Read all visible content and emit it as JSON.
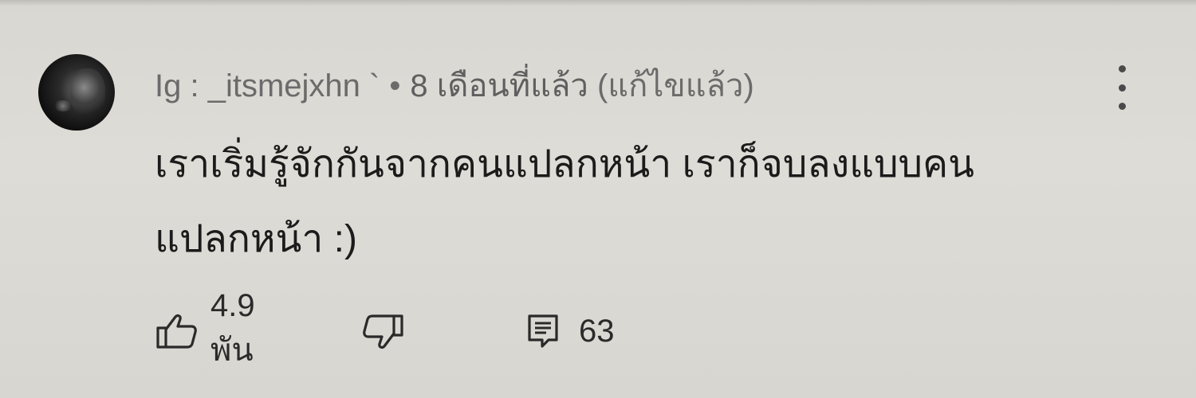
{
  "comment": {
    "author": "Ig : _itsmejxhn `",
    "separator": "•",
    "timestamp": "8 เดือนที่แล้ว",
    "edited_label": "(แก้ไขแล้ว)",
    "text_lines": [
      "เราเริ่มรู้จักกันจากคนแปลกหน้า เราก็จบลงแบบคน",
      "แปลกหน้า :)"
    ],
    "likes": "4.9 พัน",
    "replies": "63"
  },
  "icons": {
    "like": "thumbs-up-icon",
    "dislike": "thumbs-down-icon",
    "reply": "comment-icon",
    "menu": "more-vert-icon"
  },
  "colors": {
    "background": "#dcdad4",
    "meta_text": "#6b6b6b",
    "body_text": "#1b1b1b"
  }
}
